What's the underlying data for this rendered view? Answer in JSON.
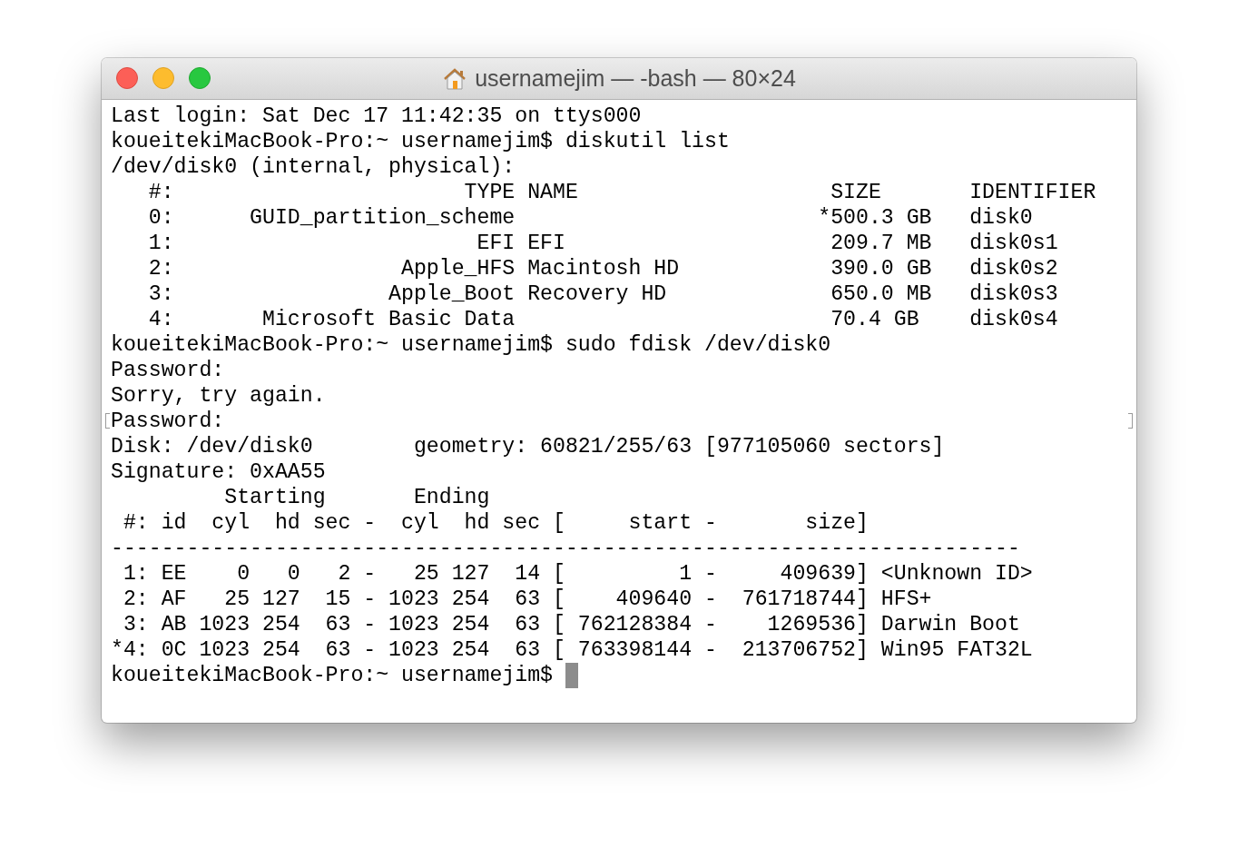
{
  "window": {
    "title": "usernamejim — -bash — 80×24"
  },
  "terminal": {
    "lines": [
      {
        "text": "Last login: Sat Dec 17 11:42:35 on ttys000",
        "marked": false
      },
      {
        "text": "koueitekiMacBook-Pro:~ usernamejim$ diskutil list",
        "marked": false
      },
      {
        "text": "/dev/disk0 (internal, physical):",
        "marked": false
      },
      {
        "text": "   #:                       TYPE NAME                    SIZE       IDENTIFIER",
        "marked": false
      },
      {
        "text": "   0:      GUID_partition_scheme                        *500.3 GB   disk0",
        "marked": false
      },
      {
        "text": "   1:                        EFI EFI                     209.7 MB   disk0s1",
        "marked": false
      },
      {
        "text": "   2:                  Apple_HFS Macintosh HD            390.0 GB   disk0s2",
        "marked": false
      },
      {
        "text": "   3:                 Apple_Boot Recovery HD             650.0 MB   disk0s3",
        "marked": false
      },
      {
        "text": "   4:       Microsoft Basic Data                         70.4 GB    disk0s4",
        "marked": false
      },
      {
        "text": "koueitekiMacBook-Pro:~ usernamejim$ sudo fdisk /dev/disk0",
        "marked": false
      },
      {
        "text": "Password:",
        "marked": false
      },
      {
        "text": "Sorry, try again.",
        "marked": false
      },
      {
        "text": "Password:",
        "marked": true
      },
      {
        "text": "Disk: /dev/disk0        geometry: 60821/255/63 [977105060 sectors]",
        "marked": false
      },
      {
        "text": "Signature: 0xAA55",
        "marked": false
      },
      {
        "text": "         Starting       Ending",
        "marked": false
      },
      {
        "text": " #: id  cyl  hd sec -  cyl  hd sec [     start -       size]",
        "marked": false
      },
      {
        "text": "------------------------------------------------------------------------",
        "marked": false
      },
      {
        "text": " 1: EE    0   0   2 -   25 127  14 [         1 -     409639] <Unknown ID>",
        "marked": false
      },
      {
        "text": " 2: AF   25 127  15 - 1023 254  63 [    409640 -  761718744] HFS+",
        "marked": false
      },
      {
        "text": " 3: AB 1023 254  63 - 1023 254  63 [ 762128384 -    1269536] Darwin Boot",
        "marked": false
      },
      {
        "text": "*4: 0C 1023 254  63 - 1023 254  63 [ 763398144 -  213706752] Win95 FAT32L",
        "marked": false
      }
    ],
    "prompt": {
      "text": "koueitekiMacBook-Pro:~ usernamejim$",
      "cursor": true
    }
  }
}
